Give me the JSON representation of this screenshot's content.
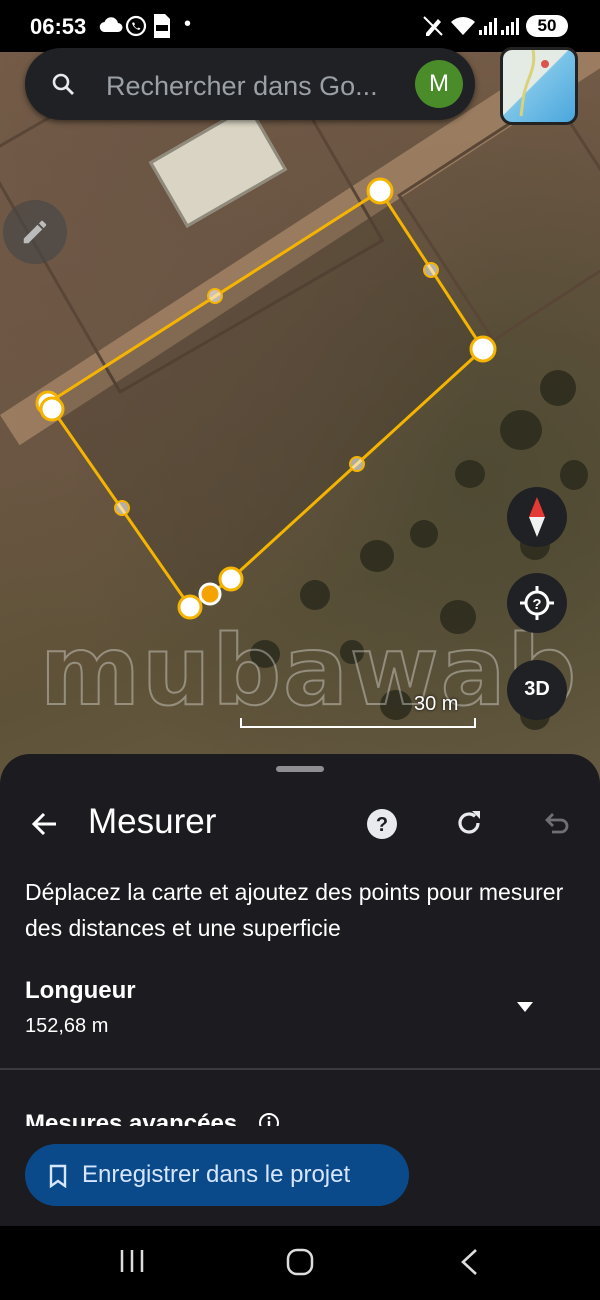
{
  "status_bar": {
    "time": "06:53",
    "dot": "•",
    "battery": "50"
  },
  "search": {
    "placeholder": "Rechercher dans Go...",
    "avatar_letter": "M"
  },
  "map": {
    "watermark": "mubawab",
    "scale_label": "30 m",
    "three_d_label": "3D",
    "polygon_color": "#f4b400"
  },
  "sheet": {
    "title": "Mesurer",
    "instructions": "Déplacez la carte et ajoutez des points pour mesurer des distances et une superficie",
    "length_label": "Longueur",
    "length_value": "152,68 m",
    "advanced_label": "Mesures avancées",
    "save_button": "Enregistrer dans le projet"
  },
  "icons": [
    "search-icon",
    "pencil-icon",
    "compass-icon",
    "location-help-icon",
    "back-arrow-icon",
    "help-icon",
    "refresh-icon",
    "undo-icon",
    "chevron-down-icon",
    "info-icon",
    "bookmark-icon",
    "recent-apps-icon",
    "home-icon",
    "nav-back-icon"
  ]
}
